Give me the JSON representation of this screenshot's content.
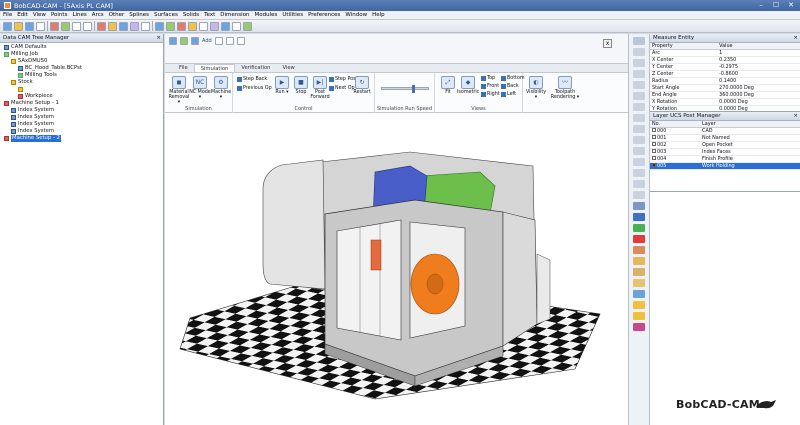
{
  "window": {
    "title": "BobCAD-CAM - [5Axis PL CAM]",
    "controls": [
      "–",
      "☐",
      "✕"
    ]
  },
  "menu": [
    "File",
    "Edit",
    "View",
    "Points",
    "Lines",
    "Arcs",
    "Other",
    "Splines",
    "Surfaces",
    "Solids",
    "Text",
    "Dimension",
    "Modules",
    "Utilities",
    "Preferences",
    "Window",
    "Help"
  ],
  "left_panel": {
    "title": "Data CAM Tree Manager",
    "nodes": [
      {
        "label": "CAM Defaults",
        "indent": 0,
        "icon": "b"
      },
      {
        "label": "Milling Job",
        "indent": 0,
        "icon": "g"
      },
      {
        "label": "5AxDMU50",
        "indent": 1,
        "icon": "y"
      },
      {
        "label": "BC_Hood_Table.BCPst",
        "indent": 2,
        "icon": "b"
      },
      {
        "label": "Milling Tools",
        "indent": 2,
        "icon": "g"
      },
      {
        "label": "Stock",
        "indent": 1,
        "icon": "y"
      },
      {
        "label": "",
        "indent": 2,
        "icon": "y"
      },
      {
        "label": "Workpiece",
        "indent": 2,
        "icon": "r"
      },
      {
        "label": "Machine Setup - 1",
        "indent": 0,
        "icon": "r"
      },
      {
        "label": "Index System",
        "indent": 1,
        "icon": "b"
      },
      {
        "label": "Index System",
        "indent": 1,
        "icon": "b"
      },
      {
        "label": "Index System",
        "indent": 1,
        "icon": "b"
      },
      {
        "label": "Index System",
        "indent": 1,
        "icon": "b"
      },
      {
        "label": "Machine Setup - 2",
        "indent": 0,
        "icon": "r",
        "selected": true
      }
    ]
  },
  "ribbon": {
    "quick_label": "Add",
    "tabs": [
      "File",
      "Simulation",
      "Verification",
      "View"
    ],
    "active_tab": "Simulation",
    "groups": {
      "simulation": {
        "label": "Simulation",
        "buttons": [
          "Material Removal ▾",
          "NC Mode ▾",
          "Machine ▾"
        ]
      },
      "control": {
        "label": "Control",
        "step_back": "Step Back",
        "prev_op": "Previous Op",
        "run": "Run ▾",
        "stop": "Stop",
        "post_forward": "Post Forward",
        "step_post": "Step Post",
        "next_op": "Next Op",
        "restart": "Restart"
      },
      "speed": {
        "label": "Simulation Run Speed"
      },
      "views": {
        "label": "Views",
        "fit": "Fit",
        "isometric": "Isometric",
        "top": "Top",
        "front": "Front",
        "right": "Right",
        "bottom": "Bottom",
        "back": "Back",
        "left": "Left"
      },
      "visibility": {
        "visibility": "Visibility ▾",
        "toolpath": "Toolpath Rendering ▾"
      }
    }
  },
  "measure": {
    "title": "Measure Entity",
    "headers": [
      "Property",
      "Value"
    ],
    "rows": [
      [
        "Arc",
        "1"
      ],
      [
        "X Center",
        "0.2350"
      ],
      [
        "Y Center",
        "-0.2975"
      ],
      [
        "Z Center",
        "-0.8600"
      ],
      [
        "Radius",
        "0.1400"
      ],
      [
        "Start Angle",
        "270.0000 Deg"
      ],
      [
        "End Angle",
        "360.0000 Deg"
      ],
      [
        "X Rotation",
        "0.0000 Deg"
      ],
      [
        "Y Rotation",
        "0.0000 Deg"
      ]
    ]
  },
  "layers": {
    "title": "Layer UCS Post Manager",
    "headers": [
      "No.",
      "Layer"
    ],
    "rows": [
      {
        "no": "000",
        "name": "CAD",
        "on": false
      },
      {
        "no": "001",
        "name": "Not Named",
        "on": false
      },
      {
        "no": "002",
        "name": "Open Pocket",
        "on": false
      },
      {
        "no": "003",
        "name": "Index Faces",
        "on": false
      },
      {
        "no": "004",
        "name": "Finish Profile",
        "on": false
      },
      {
        "no": "005",
        "name": "Work Holding",
        "on": true,
        "selected": true
      }
    ]
  },
  "brand": "BobCAD-CAM"
}
